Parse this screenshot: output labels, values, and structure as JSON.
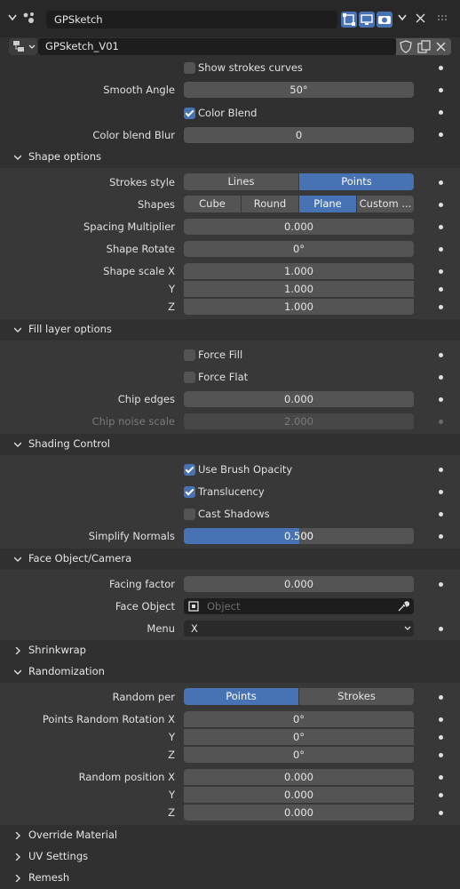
{
  "header": {
    "object_name": "GPSketch",
    "modifier_name": "GPSketch_V01"
  },
  "icons": [
    "chevron-down-icon",
    "modifier-icon",
    "edit-mode-icon",
    "viewport-icon",
    "render-icon",
    "close-icon",
    "drag-icon",
    "node-group-icon",
    "shield-icon",
    "copy-icon",
    "close-icon"
  ],
  "top_rows": {
    "show_strokes_curves": {
      "label": "Show strokes curves",
      "checked": false
    },
    "smooth_angle": {
      "label": "Smooth Angle",
      "value": "50°"
    },
    "color_blend": {
      "label": "Color Blend",
      "checked": true
    },
    "color_blend_blur": {
      "label": "Color blend Blur",
      "value": "0"
    }
  },
  "shape_options": {
    "title": "Shape options",
    "strokes_style": {
      "label": "Strokes style",
      "options": [
        "Lines",
        "Points"
      ],
      "selected": "Points"
    },
    "shapes": {
      "label": "Shapes",
      "options": [
        "Cube",
        "Round",
        "Plane",
        "Custom ..."
      ],
      "selected": "Plane"
    },
    "spacing_multiplier": {
      "label": "Spacing Multiplier",
      "value": "0.000"
    },
    "shape_rotate": {
      "label": "Shape Rotate",
      "value": "0°"
    },
    "shape_scale_x": {
      "label": "Shape scale X",
      "value": "1.000"
    },
    "shape_scale_y": {
      "label": "Y",
      "value": "1.000"
    },
    "shape_scale_z": {
      "label": "Z",
      "value": "1.000"
    }
  },
  "fill_layer_options": {
    "title": "Fill layer options",
    "force_fill": {
      "label": "Force Fill",
      "checked": false
    },
    "force_flat": {
      "label": "Force Flat",
      "checked": false
    },
    "chip_edges": {
      "label": "Chip edges",
      "value": "0.000"
    },
    "chip_noise_scale": {
      "label": "Chip noise scale",
      "value": "2.000"
    }
  },
  "shading_control": {
    "title": "Shading Control",
    "use_brush_opacity": {
      "label": "Use Brush Opacity",
      "checked": true
    },
    "translucency": {
      "label": "Translucency",
      "checked": true
    },
    "cast_shadows": {
      "label": "Cast Shadows",
      "checked": false
    },
    "simplify_normals": {
      "label": "Simplify Normals",
      "value": "0.500",
      "fraction": 0.5
    }
  },
  "face_object_camera": {
    "title": "Face Object/Camera",
    "facing_factor": {
      "label": "Facing factor",
      "value": "0.000"
    },
    "face_object": {
      "label": "Face Object",
      "placeholder": "Object"
    },
    "menu": {
      "label": "Menu",
      "value": "X"
    }
  },
  "shrinkwrap": {
    "title": "Shrinkwrap"
  },
  "randomization": {
    "title": "Randomization",
    "random_per": {
      "label": "Random per",
      "options": [
        "Points",
        "Strokes"
      ],
      "selected": "Points"
    },
    "rot_x": {
      "label": "Points Random Rotation X",
      "value": "0°"
    },
    "rot_y": {
      "label": "Y",
      "value": "0°"
    },
    "rot_z": {
      "label": "Z",
      "value": "0°"
    },
    "pos_x": {
      "label": "Random position X",
      "value": "0.000"
    },
    "pos_y": {
      "label": "Y",
      "value": "0.000"
    },
    "pos_z": {
      "label": "Z",
      "value": "0.000"
    }
  },
  "override_material": {
    "title": "Override Material"
  },
  "uv_settings": {
    "title": "UV Settings"
  },
  "remesh": {
    "title": "Remesh"
  }
}
